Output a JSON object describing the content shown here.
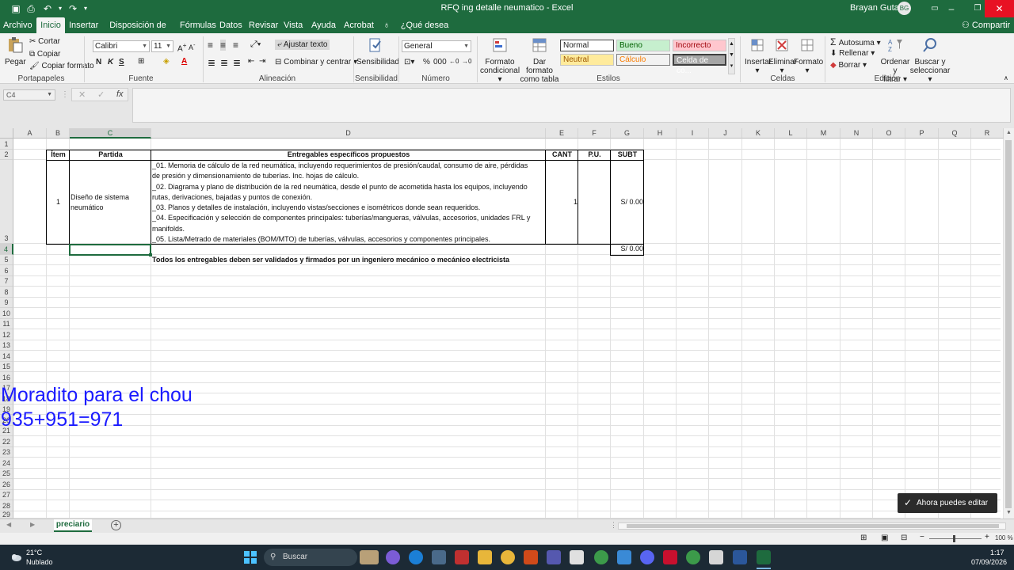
{
  "window": {
    "title": "RFQ ing detalle neumatico  -  Excel",
    "user_name": "Brayan Gutarra",
    "user_initials": "BG"
  },
  "ribbon_tabs": [
    "Archivo",
    "Inicio",
    "Insertar",
    "Disposición de página",
    "Fórmulas",
    "Datos",
    "Revisar",
    "Vista",
    "Ayuda",
    "Acrobat",
    "¿Qué desea hacer?"
  ],
  "share_label": "Compartir",
  "ribbon": {
    "clipboard": {
      "paste": "Pegar",
      "cut": "Cortar",
      "copy": "Copiar",
      "format_painter": "Copiar formato",
      "label": "Portapapeles"
    },
    "font": {
      "name": "Calibri",
      "size": "11",
      "bold": "N",
      "italic": "K",
      "underline": "S",
      "label": "Fuente"
    },
    "alignment": {
      "wrap": "Ajustar texto",
      "merge": "Combinar y centrar",
      "label": "Alineación"
    },
    "sensitivity": {
      "button": "Sensibilidad",
      "label": "Sensibilidad"
    },
    "number": {
      "format": "General",
      "label": "Número"
    },
    "styles": {
      "cond_format": [
        "Formato",
        "condicional"
      ],
      "as_table": [
        "Dar formato",
        "como tabla"
      ],
      "normal": "Normal",
      "good": "Bueno",
      "bad": "Incorrecto",
      "neutral": "Neutral",
      "calc": "Cálculo",
      "check": "Celda de co...",
      "label": "Estilos"
    },
    "cells": {
      "insert": "Insertar",
      "delete": "Eliminar",
      "format": "Formato",
      "label": "Celdas"
    },
    "editing": {
      "autosum": "Autosuma",
      "fill": "Rellenar",
      "clear": "Borrar",
      "sort": [
        "Ordenar y",
        "filtrar"
      ],
      "find": [
        "Buscar y",
        "seleccionar"
      ],
      "label": "Edición"
    }
  },
  "name_box": "C4",
  "columns": [
    "A",
    "B",
    "C",
    "D",
    "E",
    "F",
    "G",
    "H",
    "I",
    "J",
    "K",
    "L",
    "M",
    "N",
    "O",
    "P",
    "Q",
    "R"
  ],
  "rows": [
    "1",
    "2",
    "3",
    "4",
    "5",
    "6",
    "7",
    "8",
    "9",
    "10",
    "11",
    "12",
    "13",
    "14",
    "15",
    "16",
    "17",
    "18",
    "19",
    "20",
    "21",
    "22",
    "23",
    "24",
    "25",
    "26",
    "27",
    "28",
    "29"
  ],
  "table": {
    "headers": {
      "item": "Ítem",
      "partida": "Partida",
      "entregables": "Entregables específicos propuestos",
      "cant": "CANT",
      "pu": "P.U.",
      "subt": "SUBT"
    },
    "row1": {
      "item": "1",
      "partida": "Diseño de sistema neumático",
      "entregables": [
        "_01. Memoria de cálculo de la red neumática, incluyendo requerimientos de presión/caudal, consumo de aire, pérdidas",
        "de presión y dimensionamiento de tuberías. Inc. hojas de cálculo.",
        "_02. Diagrama y plano de distribución de la red neumática, desde el punto de acometida hasta los equipos, incluyendo",
        "rutas, derivaciones, bajadas y puntos de conexión.",
        "_03. Planos y detalles de instalación, incluyendo vistas/secciones e isométricos donde sean requeridos.",
        "_04. Especificación y selección de componentes principales: tuberías/mangueras, válvulas, accesorios, unidades FRL y",
        "manifolds.",
        "_05. Lista/Metrado de materiales (BOM/MTO) de tuberías, válvulas, accesorios y componentes principales."
      ],
      "cant": "1",
      "subt": "S/ 0.00"
    },
    "total": "S/ 0.00",
    "note": "Todos los entregables deben ser validados y firmados por un ingeniero mecánico o mecánico electricista"
  },
  "ink_annotations": [
    "Moradito para el chou",
    "935+951=971"
  ],
  "sheet_tab": "preciario",
  "toast": "Ahora puedes editar",
  "zoom": "100 %",
  "taskbar": {
    "temperature": "21°C",
    "weather": "Nublado",
    "search": "Buscar",
    "time": "1:17",
    "date": "07/09/2026"
  }
}
